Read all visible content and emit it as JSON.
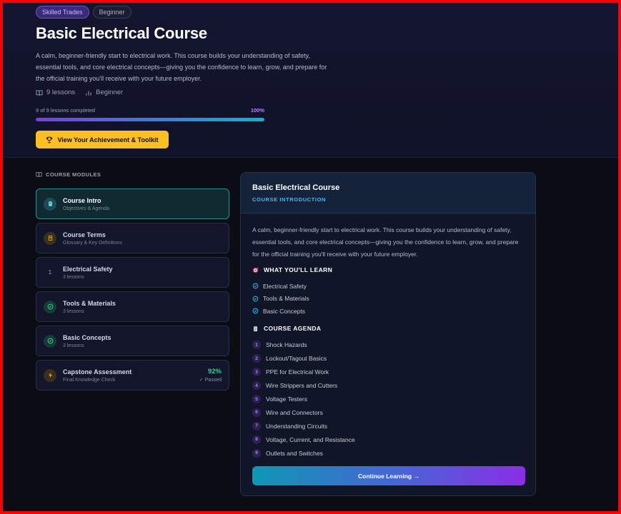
{
  "hero": {
    "tags": [
      "Skilled Trades",
      "Beginner"
    ],
    "title": "Basic Electrical Course",
    "description": "A calm, beginner-friendly start to electrical work. This course builds your understanding of safety, essential tools, and core electrical concepts—giving you the confidence to learn, grow, and prepare for the official training you'll receive with your future employer.",
    "lessons_count": "9 lessons",
    "level": "Beginner",
    "progress_text": "9 of 9 lessons completed",
    "progress_percent": "100%",
    "progress_fraction": 1.0,
    "achievement_button": "View Your Achievement & Toolkit"
  },
  "modules": {
    "heading": "COURSE MODULES",
    "items": [
      {
        "title": "Course Intro",
        "subtitle": "Objectives & Agenda",
        "icon": "book-icon",
        "active": true
      },
      {
        "title": "Course Terms",
        "subtitle": "Glossary & Key Definitions",
        "icon": "glossary-icon"
      },
      {
        "title": "Electrical Safety",
        "subtitle": "3 lessons",
        "icon_text": "1"
      },
      {
        "title": "Tools & Materials",
        "subtitle": "3 lessons",
        "icon": "check-circle-icon"
      },
      {
        "title": "Basic Concepts",
        "subtitle": "3 lessons",
        "icon": "check-circle-icon"
      },
      {
        "title": "Capstone Assessment",
        "subtitle": "Final Knowledge Check",
        "icon": "bolt-icon",
        "score": "92%",
        "score_status": "✓ Passed"
      }
    ]
  },
  "detail": {
    "title": "Basic Electrical Course",
    "subtitle": "COURSE INTRODUCTION",
    "description": "A calm, beginner-friendly start to electrical work. This course builds your understanding of safety, essential tools, and core electrical concepts—giving you the confidence to learn, grow, and prepare for the official training you'll receive with your future employer.",
    "learn_heading": "WHAT YOU'LL LEARN",
    "learn_items": [
      "Electrical Safety",
      "Tools & Materials",
      "Basic Concepts"
    ],
    "agenda_heading": "COURSE AGENDA",
    "agenda_items": [
      {
        "num": "1",
        "label": "Shock Hazards"
      },
      {
        "num": "2",
        "label": "Lockout/Tagout Basics"
      },
      {
        "num": "3",
        "label": "PPE for Electrical Work"
      },
      {
        "num": "4",
        "label": "Wire Strippers and Cutters"
      },
      {
        "num": "5",
        "label": "Voltage Testers"
      },
      {
        "num": "6",
        "label": "Wire and Connectors"
      },
      {
        "num": "7",
        "label": "Understanding Circuits"
      },
      {
        "num": "8",
        "label": "Voltage, Current, and Resistance"
      },
      {
        "num": "9",
        "label": "Outlets and Switches"
      }
    ],
    "continue_button": "Continue Learning →"
  },
  "colors": {
    "accent_gold": "#fbbf24",
    "accent_cyan": "#38bdf8",
    "accent_green": "#34d399",
    "accent_purple": "#a78bfa"
  }
}
